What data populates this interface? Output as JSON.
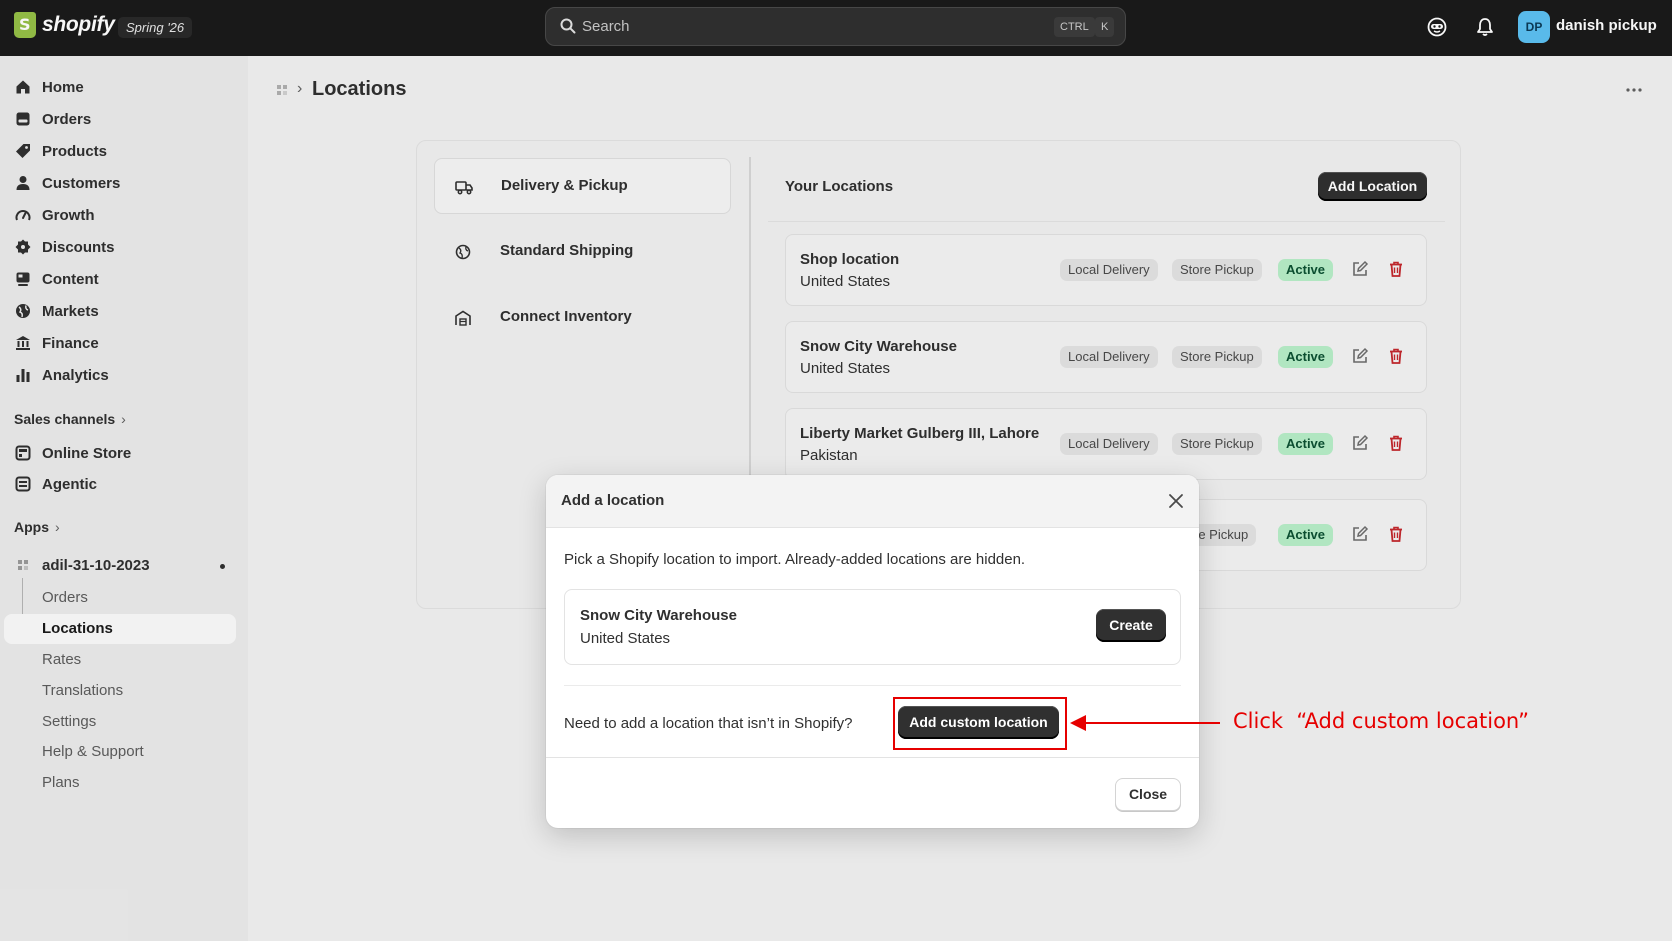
{
  "topbar": {
    "brand": "shopify",
    "edition": "Spring '26",
    "search_placeholder": "Search",
    "shortcut_key1": "CTRL",
    "shortcut_key2": "K",
    "avatar_initials": "DP",
    "username": "danish pickup"
  },
  "sidebar": {
    "main_items": [
      {
        "label": "Home",
        "icon": "home-icon"
      },
      {
        "label": "Orders",
        "icon": "orders-icon"
      },
      {
        "label": "Products",
        "icon": "tag-icon"
      },
      {
        "label": "Customers",
        "icon": "person-icon"
      },
      {
        "label": "Growth",
        "icon": "gauge-icon"
      },
      {
        "label": "Discounts",
        "icon": "discount-icon"
      },
      {
        "label": "Content",
        "icon": "content-icon"
      },
      {
        "label": "Markets",
        "icon": "globe-icon"
      },
      {
        "label": "Finance",
        "icon": "bank-icon"
      },
      {
        "label": "Analytics",
        "icon": "chart-icon"
      }
    ],
    "sales_channels_label": "Sales channels",
    "channels": [
      {
        "label": "Online Store",
        "icon": "store-icon"
      },
      {
        "label": "Agentic",
        "icon": "agent-icon"
      }
    ],
    "apps_label": "Apps",
    "app_name": "adil-31-10-2023",
    "app_subitems": [
      {
        "label": "Orders"
      },
      {
        "label": "Locations"
      },
      {
        "label": "Rates"
      },
      {
        "label": "Translations"
      },
      {
        "label": "Settings"
      },
      {
        "label": "Help & Support"
      },
      {
        "label": "Plans"
      }
    ]
  },
  "page": {
    "title": "Locations"
  },
  "shipping_nav": [
    {
      "label": "Delivery & Pickup",
      "icon": "truck-icon"
    },
    {
      "label": "Standard Shipping",
      "icon": "globe-icon"
    },
    {
      "label": "Connect Inventory",
      "icon": "warehouse-icon"
    }
  ],
  "locations": {
    "title": "Your Locations",
    "add_button": "Add Location",
    "rows": [
      {
        "name": "Shop location",
        "country": "United States",
        "badge1": "Local Delivery",
        "badge2": "Store Pickup",
        "status": "Active"
      },
      {
        "name": "Snow City Warehouse",
        "country": "United States",
        "badge1": "Local Delivery",
        "badge2": "Store Pickup",
        "status": "Active"
      },
      {
        "name": "Liberty Market Gulberg III, Lahore",
        "country": "Pakistan",
        "badge1": "Local Delivery",
        "badge2": "Store Pickup",
        "status": "Active"
      },
      {
        "badge2": "re Pickup",
        "status": "Active"
      }
    ]
  },
  "modal": {
    "title": "Add a location",
    "description": "Pick a Shopify location to import. Already-added locations are hidden.",
    "import_name": "Snow City Warehouse",
    "import_country": "United States",
    "create_button": "Create",
    "custom_question": "Need to add a location that isn’t in Shopify?",
    "custom_button": "Add custom location",
    "close_button": "Close"
  },
  "annotation": {
    "text": "Click  “Add custom location”"
  },
  "colors": {
    "topbar": "#1a1a1a",
    "brand_green": "#95bf47",
    "active_badge": "#b7eec8",
    "annotation_red": "#e60000",
    "delete_red": "#c4282d"
  }
}
